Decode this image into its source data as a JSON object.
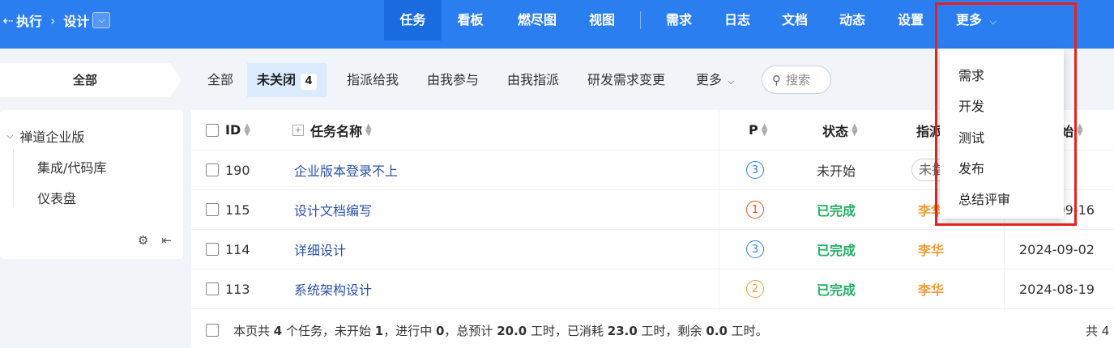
{
  "breadcrumb": {
    "back_icon": "back-arrow-icon",
    "project": "执行",
    "current": "设计"
  },
  "nav": {
    "items": [
      {
        "label": "任务",
        "active": true
      },
      {
        "label": "看板"
      },
      {
        "label": "燃尽图"
      },
      {
        "label": "视图"
      },
      {
        "label": "需求"
      },
      {
        "label": "日志"
      },
      {
        "label": "文档"
      },
      {
        "label": "动态"
      },
      {
        "label": "设置"
      },
      {
        "label": "更多"
      }
    ]
  },
  "sidebar": {
    "header": "全部",
    "tree": {
      "root": "禅道企业版",
      "children": [
        "集成/代码库",
        "仪表盘"
      ]
    },
    "tools": [
      "gear-icon",
      "collapse-left-icon"
    ]
  },
  "filters": {
    "tabs": [
      {
        "label": "全部"
      },
      {
        "label": "未关闭",
        "badge": "4",
        "active": true
      },
      {
        "label": "指派给我"
      },
      {
        "label": "由我参与"
      },
      {
        "label": "由我指派"
      },
      {
        "label": "研发需求变更"
      },
      {
        "label": "更多"
      }
    ],
    "search_label": "搜索"
  },
  "table": {
    "columns": [
      "ID",
      "任务名称",
      "P",
      "状态",
      "指派给",
      "预计开始"
    ],
    "rows": [
      {
        "id": "190",
        "name": "企业版本登录不上",
        "pri": "3",
        "status": "未开始",
        "assignee": "未指派",
        "start": ""
      },
      {
        "id": "115",
        "name": "设计文档编写",
        "pri": "1",
        "status": "已完成",
        "assignee": "李华",
        "start": "2024-09-16"
      },
      {
        "id": "114",
        "name": "详细设计",
        "pri": "3",
        "status": "已完成",
        "assignee": "李华",
        "start": "2024-09-02"
      },
      {
        "id": "113",
        "name": "系统架构设计",
        "pri": "2",
        "status": "已完成",
        "assignee": "李华",
        "start": "2024-08-19"
      }
    ],
    "footer": {
      "p1": "本页共 ",
      "count": "4",
      "p2": " 个任务，未开始 ",
      "notstarted": "1",
      "p3": "，进行中 ",
      "inprogress": "0",
      "p4": "，总预计 ",
      "estimate": "20.0",
      "p5": " 工时，已消耗 ",
      "consumed": "23.0",
      "p6": " 工时，剩余 ",
      "left": "0.0",
      "p7": " 工时。",
      "total_label": "共 4"
    }
  },
  "more_menu": {
    "items": [
      "需求",
      "开发",
      "测试",
      "发布",
      "总结评审"
    ]
  },
  "colors": {
    "topbar": "#2b7ef0",
    "done": "#1fae62",
    "assignee": "#f39c3a",
    "pri1": "#e8541b",
    "pri2": "#f39c3a",
    "pri3": "#2b7ef0",
    "highlight": "#e8201b"
  }
}
